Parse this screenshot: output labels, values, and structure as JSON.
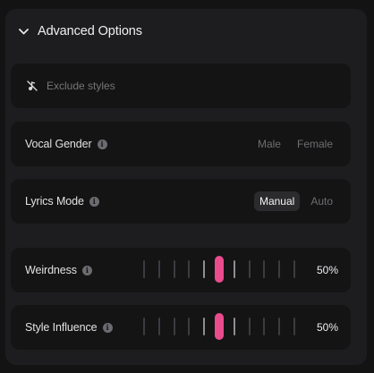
{
  "header": {
    "label": "Advanced Options",
    "icon": "chevron-down-icon"
  },
  "exclude": {
    "placeholder": "Exclude styles",
    "icon": "no-music-icon"
  },
  "vocal_gender": {
    "label": "Vocal Gender",
    "options": [
      "Male",
      "Female"
    ],
    "selected": null
  },
  "lyrics_mode": {
    "label": "Lyrics Mode",
    "options": [
      "Manual",
      "Auto"
    ],
    "selected": "Manual"
  },
  "weirdness": {
    "label": "Weirdness",
    "value": 50,
    "value_text": "50%"
  },
  "style_influence": {
    "label": "Style Influence",
    "value": 50,
    "value_text": "50%"
  },
  "colors": {
    "accent": "#e84c8c",
    "panel": "#1d1d1f",
    "card": "#141415"
  }
}
